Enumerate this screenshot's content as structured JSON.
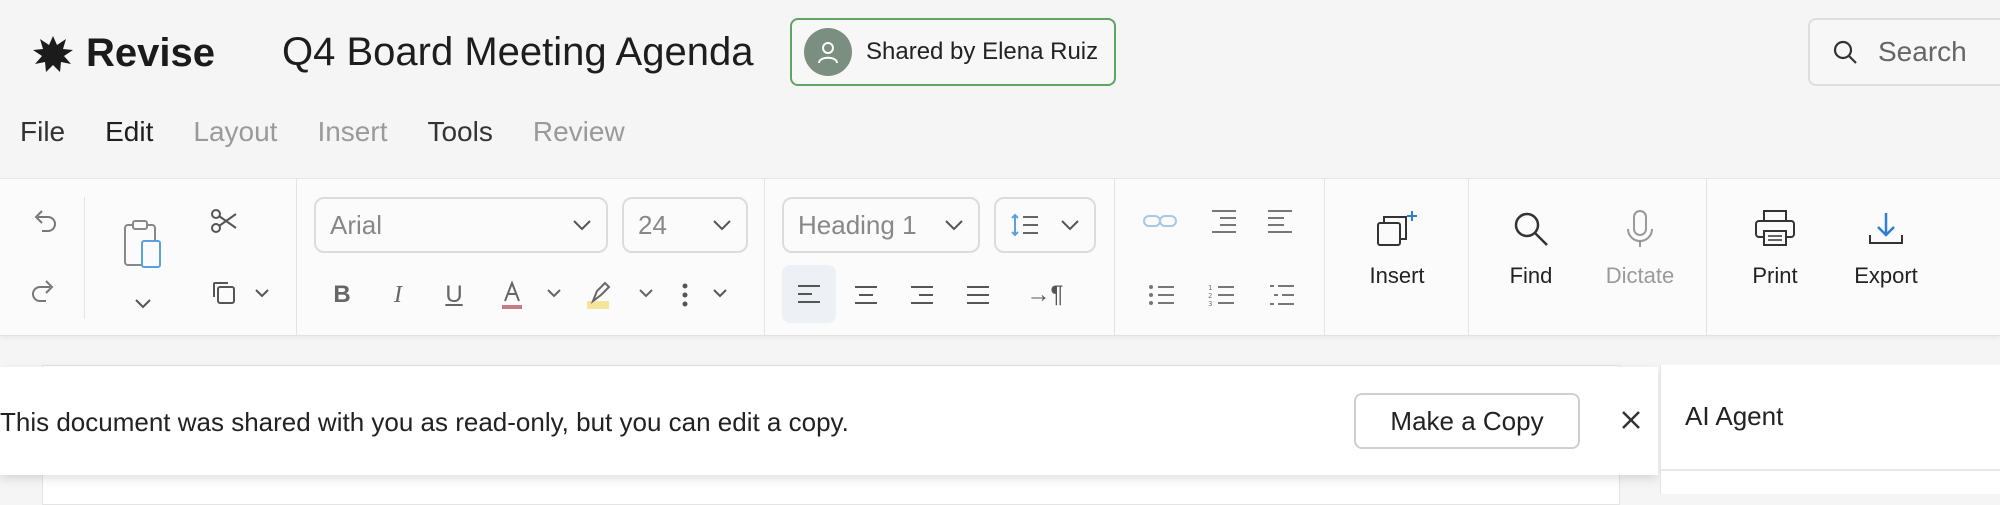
{
  "app": {
    "name": "Revise",
    "logo_icon": "splat-logo-icon"
  },
  "document": {
    "title": "Q4 Board Meeting Agenda"
  },
  "share": {
    "label": "Shared by Elena Ruiz",
    "border_color": "#5fa463",
    "avatar_icon": "person-icon"
  },
  "search": {
    "placeholder": "Search"
  },
  "menu": [
    {
      "label": "File",
      "state": "enabled"
    },
    {
      "label": "Edit",
      "state": "active"
    },
    {
      "label": "Layout",
      "state": "disabled"
    },
    {
      "label": "Insert",
      "state": "disabled"
    },
    {
      "label": "Tools",
      "state": "enabled"
    },
    {
      "label": "Review",
      "state": "disabled"
    }
  ],
  "toolbar": {
    "font_family": "Arial",
    "font_size": "24",
    "paragraph_style": "Heading 1",
    "insert_label": "Insert",
    "find_label": "Find",
    "dictate_label": "Dictate",
    "print_label": "Print",
    "export_label": "Export",
    "accent_color": "#2e7fd1"
  },
  "banner": {
    "message": "This document was shared with you as read-only, but you can edit a copy.",
    "copy_button": "Make a Copy"
  },
  "ai_panel": {
    "title": "AI Agent"
  }
}
